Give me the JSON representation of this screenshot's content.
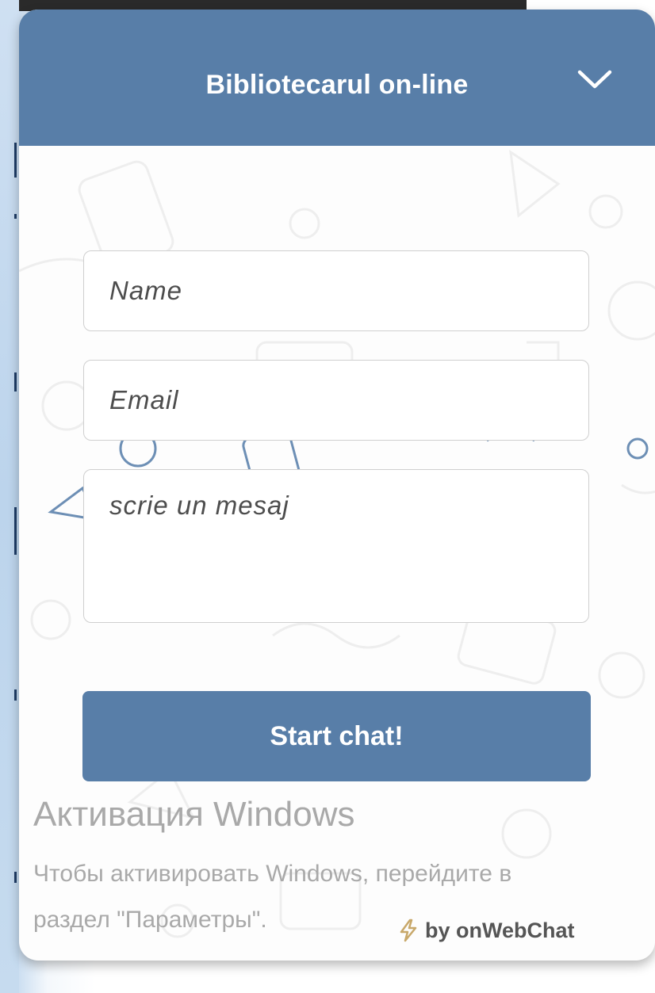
{
  "header": {
    "title": "Bibliotecarul on-line",
    "collapse_icon": "chevron-down-icon"
  },
  "form": {
    "name_placeholder": "Name",
    "email_placeholder": "Email",
    "message_placeholder": "scrie un mesaj",
    "submit_label": "Start chat!"
  },
  "watermark": {
    "title": "Активация Windows",
    "line1": "Чтобы активировать Windows, перейдите в",
    "line2": "раздел \"Параметры\"."
  },
  "footer": {
    "powered_by": "by onWebChat",
    "icon": "lightning-icon"
  },
  "colors": {
    "accent": "#587ea8",
    "header_text": "#ffffff",
    "watermark_text": "#a9a9a9"
  }
}
